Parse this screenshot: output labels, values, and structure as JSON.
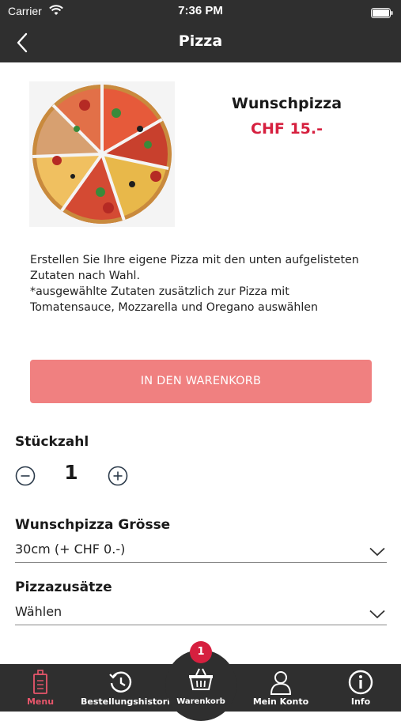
{
  "status_bar": {
    "carrier": "Carrier",
    "time": "7:36 PM"
  },
  "nav": {
    "title": "Pizza"
  },
  "product": {
    "name": "Wunschpizza",
    "price": "CHF 15.-",
    "description_lines": [
      "Erstellen Sie Ihre eigene Pizza mit den unten aufgelisteten",
      "Zutaten nach Wahl.",
      "*ausgewählte Zutaten zusätzlich zur Pizza mit",
      "Tomatensauce, Mozzarella und Oregano auswählen"
    ]
  },
  "cart_button": {
    "label": "IN DEN WARENKORB"
  },
  "quantity": {
    "label": "Stückzahl",
    "value": "1"
  },
  "size": {
    "label": "Wunschpizza Grösse",
    "selected": "30cm (+ CHF 0.-)"
  },
  "extras": {
    "label": "Pizzazusätze",
    "selected": "Wählen"
  },
  "tabbar": {
    "badge_count": "1",
    "tabs": [
      {
        "label": "Menu",
        "icon": "menu-icon",
        "active": true
      },
      {
        "label": "Bestellungshistorie",
        "icon": "history-icon",
        "active": false
      },
      {
        "label": "Warenkorb",
        "icon": "basket-icon",
        "active": false
      },
      {
        "label": "Mein Konto",
        "icon": "user-icon",
        "active": false
      },
      {
        "label": "Info",
        "icon": "info-icon",
        "active": false
      }
    ]
  },
  "colors": {
    "bar": "#2f2f2f",
    "accent": "#d6203f",
    "button": "#f08080",
    "active_tab": "#e8566b"
  }
}
